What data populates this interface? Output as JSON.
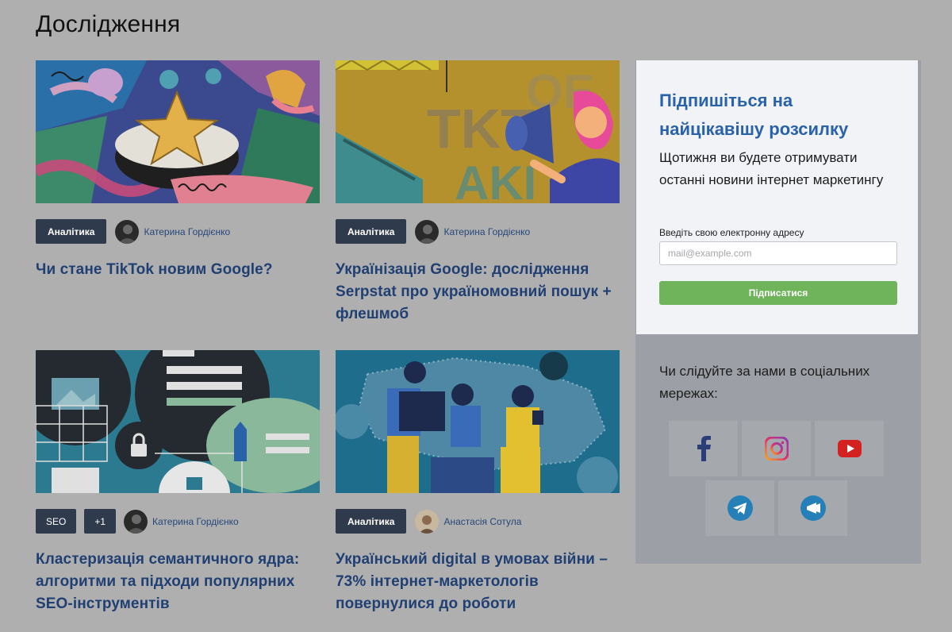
{
  "page": {
    "title": "Дослідження"
  },
  "articles": [
    {
      "tags": [
        "Аналітика"
      ],
      "author": "Катерина Гордієнко",
      "title": "Чи стане TikTok новим Google?"
    },
    {
      "tags": [
        "Аналітика"
      ],
      "author": "Катерина Гордієнко",
      "title": "Українізація Google: дослідження Serpstat про україномовний пошук + флешмоб"
    },
    {
      "tags": [
        "SEO",
        "+1"
      ],
      "author": "Катерина Гордієнко",
      "title": "Кластеризація семантичного ядра: алгоритми та підходи популярних SEO-інструментів"
    },
    {
      "tags": [
        "Аналітика"
      ],
      "author": "Анастасія Сотула",
      "title": "Український digital в умовах війни – 73% інтернет-маркетологів повернулися до роботи"
    }
  ],
  "subscribe": {
    "title": "Підпишіться на найцікавішу розсилку",
    "text": "Щотижня ви будете отримувати останні новини інтернет маркетингу",
    "label": "Введіть свою електронну адресу",
    "placeholder": "mail@example.com",
    "button": "Підписатися"
  },
  "social": {
    "heading": "Чи слідуйте за нами в соціальних мережах:",
    "icons": [
      "facebook-icon",
      "instagram-icon",
      "youtube-icon",
      "telegram-icon",
      "telegram-channel-icon"
    ]
  },
  "colors": {
    "page_bg": "#afafaf",
    "tag_bg": "#2f3a4c",
    "title_link": "#203f72",
    "subscribe_title": "#2a62a9",
    "button_green": "#6fb35a",
    "facebook": "#2c3e78",
    "youtube": "#d42222",
    "telegram": "#2580b8"
  }
}
